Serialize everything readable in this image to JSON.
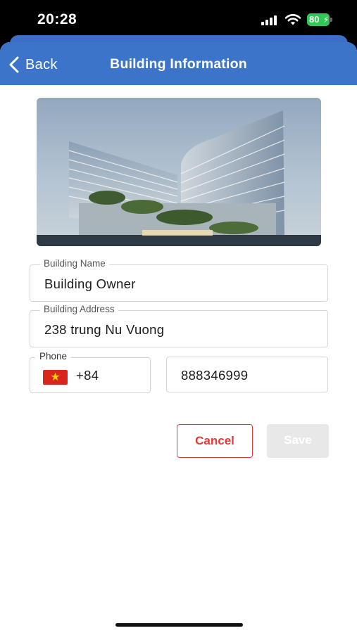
{
  "status_bar": {
    "time": "20:28",
    "battery": "80"
  },
  "nav": {
    "back_label": "Back",
    "title": "Building Information"
  },
  "form": {
    "building_name": {
      "label": "Building Name",
      "value": "Building Owner"
    },
    "building_address": {
      "label": "Building Address",
      "value": "238 trung Nu Vuong"
    },
    "phone": {
      "label": "Phone",
      "country_code": "+84",
      "number": "888346999"
    }
  },
  "actions": {
    "cancel_label": "Cancel",
    "save_label": "Save"
  },
  "colors": {
    "nav": "#3b74c8",
    "cancel": "#e53935",
    "save_disabled": "#e8e8e8",
    "battery": "#33c759"
  },
  "icons": [
    "chevron-left-icon",
    "signal-icon",
    "wifi-icon",
    "battery-icon",
    "vietnam-flag-icon"
  ]
}
